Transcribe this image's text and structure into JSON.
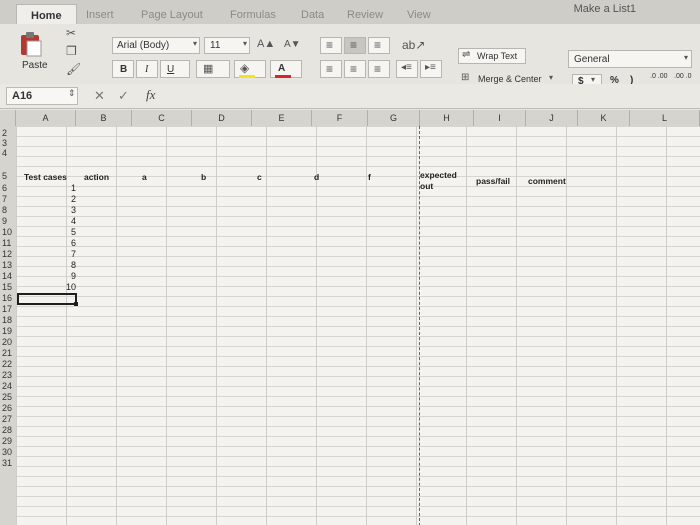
{
  "window": {
    "title": "Make a List1"
  },
  "tabs": [
    {
      "label": "Home",
      "active": true
    },
    {
      "label": "Insert"
    },
    {
      "label": "Page Layout"
    },
    {
      "label": "Formulas"
    },
    {
      "label": "Data"
    },
    {
      "label": "Review"
    },
    {
      "label": "View"
    }
  ],
  "ribbon": {
    "paste_label": "Paste",
    "font_name": "Arial (Body)",
    "font_size": "11",
    "bold": "B",
    "italic": "I",
    "underline": "U",
    "font_color_glyph": "A",
    "wrap_text": "Wrap Text",
    "merge_center": "Merge & Center",
    "number_format": "General",
    "currency": "$",
    "percent": "%",
    "comma": ")",
    "inc_decimal": ".0 .00",
    "dec_decimal": ".00 .0"
  },
  "formula_bar": {
    "name_box": "A16",
    "fx": "fx",
    "cancel": "✕",
    "enter": "✓"
  },
  "columns": [
    "A",
    "B",
    "C",
    "D",
    "E",
    "F",
    "G",
    "H",
    "I",
    "J",
    "K",
    "L"
  ],
  "rows": [
    "2",
    "3",
    "4",
    "5",
    "6",
    "7",
    "8",
    "9",
    "10",
    "11",
    "12",
    "13",
    "14",
    "15",
    "16",
    "17",
    "18",
    "19",
    "20",
    "21",
    "22",
    "23",
    "24",
    "25",
    "26",
    "27",
    "28",
    "29",
    "30",
    "31"
  ],
  "sheet": {
    "headers": {
      "test_cases": "Test cases",
      "action": "action",
      "a": "a",
      "b": "b",
      "c": "c",
      "d": "d",
      "f": "f",
      "expected_line1": "expected",
      "expected_line2": "out",
      "pass_fail": "pass/fail",
      "comment": "comment"
    },
    "test_numbers": [
      "1",
      "2",
      "3",
      "4",
      "5",
      "6",
      "7",
      "8",
      "9",
      "10"
    ]
  },
  "colors": {
    "grid_bg": "#f4f3ef",
    "header_bg": "#d6d4cf",
    "selection": "#1f1f1f"
  }
}
